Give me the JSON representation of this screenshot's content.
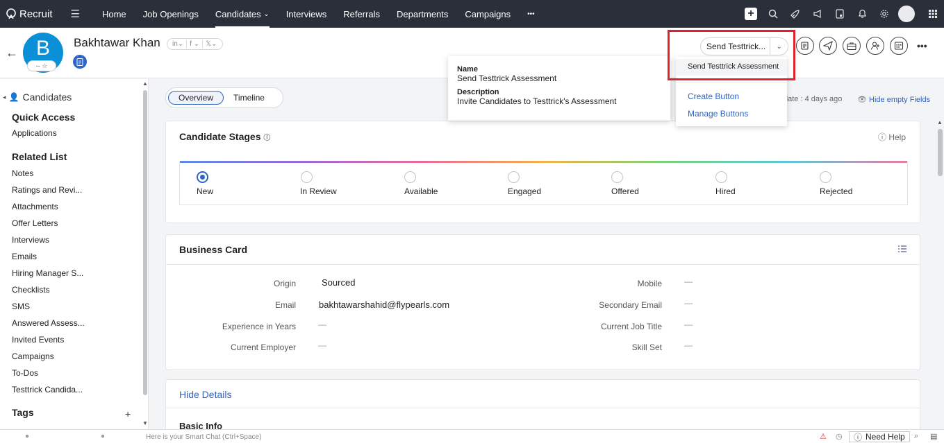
{
  "app": {
    "brand": "Recruit"
  },
  "nav": {
    "items": [
      {
        "label": "Home",
        "active": false
      },
      {
        "label": "Job Openings",
        "active": false
      },
      {
        "label": "Candidates",
        "active": true
      },
      {
        "label": "Interviews",
        "active": false
      },
      {
        "label": "Referrals",
        "active": false
      },
      {
        "label": "Departments",
        "active": false
      },
      {
        "label": "Campaigns",
        "active": false
      }
    ],
    "candidates_caret": "⌄",
    "more": "•••"
  },
  "header": {
    "avatar_letter": "B",
    "avatar_rating": "-- ☆",
    "name": "Bakhtawar Khan",
    "socials": [
      "in⌄",
      "f ⌄",
      "𝕏⌄"
    ],
    "send_button_label": "Send Testtrick...",
    "more": "•••"
  },
  "dropdown": {
    "highlighted": "Send Testtrick Assessment",
    "links": [
      "Create Button",
      "Manage Buttons"
    ]
  },
  "tooltip": {
    "name_label": "Name",
    "name_value": "Send Testtrick Assessment",
    "desc_label": "Description",
    "desc_value": "Invite Candidates to Testtrick's Assessment"
  },
  "sidebar": {
    "title": "Candidates",
    "quick_access": "Quick Access",
    "quick_items": [
      "Applications"
    ],
    "related_list": "Related List",
    "related_items": [
      "Notes",
      "Ratings and Revi...",
      "Attachments",
      "Offer Letters",
      "Interviews",
      "Emails",
      "Hiring Manager S...",
      "Checklists",
      "SMS",
      "Answered Assess...",
      "Invited Events",
      "Campaigns",
      "To-Dos",
      "Testtrick Candida..."
    ],
    "tags": "Tags",
    "tags_add": "+"
  },
  "main": {
    "tabs": [
      {
        "label": "Overview",
        "selected": true
      },
      {
        "label": "Timeline",
        "selected": false
      }
    ],
    "last_update": "date : 4 days ago",
    "hide_empty": "Hide empty Fields",
    "stages_title": "Candidate Stages",
    "help": "Help",
    "stages": [
      {
        "label": "New",
        "selected": true
      },
      {
        "label": "In Review",
        "selected": false
      },
      {
        "label": "Available",
        "selected": false
      },
      {
        "label": "Engaged",
        "selected": false
      },
      {
        "label": "Offered",
        "selected": false
      },
      {
        "label": "Hired",
        "selected": false
      },
      {
        "label": "Rejected",
        "selected": false
      }
    ],
    "business_card_title": "Business Card",
    "fields_left": [
      {
        "label": "Origin",
        "value": "Sourced"
      },
      {
        "label": "Email",
        "value": "bakhtawarshahid@flypearls.com"
      },
      {
        "label": "Experience in Years",
        "value": "—"
      },
      {
        "label": "Current Employer",
        "value": "—"
      }
    ],
    "fields_right": [
      {
        "label": "Mobile",
        "value": "—"
      },
      {
        "label": "Secondary Email",
        "value": "—"
      },
      {
        "label": "Current Job Title",
        "value": "—"
      },
      {
        "label": "Skill Set",
        "value": "—"
      }
    ],
    "hide_details": "Hide Details",
    "basic_info": "Basic Info"
  },
  "bottom": {
    "smart_chat_placeholder": "Here is your Smart Chat (Ctrl+Space)",
    "need_help": "Need Help"
  }
}
